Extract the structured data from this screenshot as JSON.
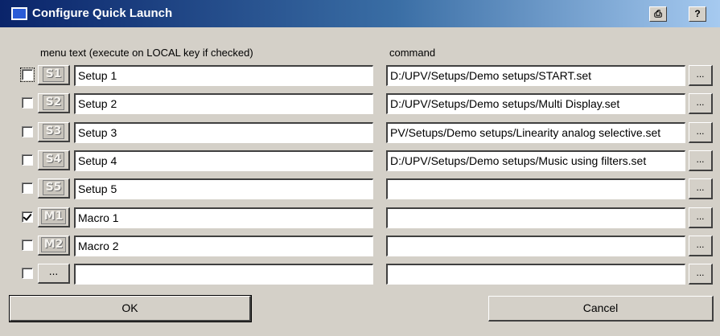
{
  "window": {
    "title": "Configure Quick Launch",
    "print_button": "⎙",
    "help_button": "?"
  },
  "headers": {
    "menu_text": "menu text (execute on LOCAL key if checked)",
    "command": "command"
  },
  "rows": [
    {
      "checked": false,
      "focused": true,
      "key": "S1",
      "menu_text": "Setup 1",
      "command": "D:/UPV/Setups/Demo setups/START.set",
      "browse": "..."
    },
    {
      "checked": false,
      "focused": false,
      "key": "S2",
      "menu_text": "Setup 2",
      "command": "D:/UPV/Setups/Demo setups/Multi Display.set",
      "browse": "..."
    },
    {
      "checked": false,
      "focused": false,
      "key": "S3",
      "menu_text": "Setup 3",
      "command": "PV/Setups/Demo setups/Linearity analog selective.set",
      "browse": "..."
    },
    {
      "checked": false,
      "focused": false,
      "key": "S4",
      "menu_text": "Setup 4",
      "command": "D:/UPV/Setups/Demo setups/Music using filters.set",
      "browse": "..."
    },
    {
      "checked": false,
      "focused": false,
      "key": "S5",
      "menu_text": "Setup 5",
      "command": "",
      "browse": "..."
    },
    {
      "checked": true,
      "focused": false,
      "key": "M1",
      "menu_text": "Macro 1",
      "command": "",
      "browse": "..."
    },
    {
      "checked": false,
      "focused": false,
      "key": "M2",
      "menu_text": "Macro 2",
      "command": "",
      "browse": "..."
    },
    {
      "checked": false,
      "focused": false,
      "key": "...",
      "menu_text": "",
      "command": "",
      "browse": "..."
    }
  ],
  "buttons": {
    "ok": "OK",
    "cancel": "Cancel"
  },
  "colors": {
    "titlebar_start": "#0a246a",
    "titlebar_end": "#a6caf0",
    "dialog_face": "#d4d0c8"
  }
}
